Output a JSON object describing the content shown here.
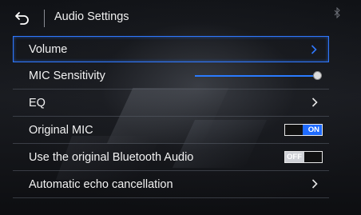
{
  "header": {
    "title": "Audio Settings",
    "back_icon": "back-arrow-icon",
    "status_icon": "bluetooth-icon"
  },
  "colors": {
    "accent": "#2f78ff",
    "toggle_on": "#1f6bff",
    "text": "#f2f2f2"
  },
  "items": [
    {
      "label": "Volume",
      "control": "chevron",
      "selected": true
    },
    {
      "label": "MIC Sensitivity",
      "control": "slider",
      "value": 1.0
    },
    {
      "label": "EQ",
      "control": "chevron"
    },
    {
      "label": "Original MIC",
      "control": "toggle",
      "state": "ON"
    },
    {
      "label": "Use the original Bluetooth Audio",
      "control": "toggle",
      "state": "OFF"
    },
    {
      "label": "Automatic echo cancellation",
      "control": "chevron"
    }
  ]
}
